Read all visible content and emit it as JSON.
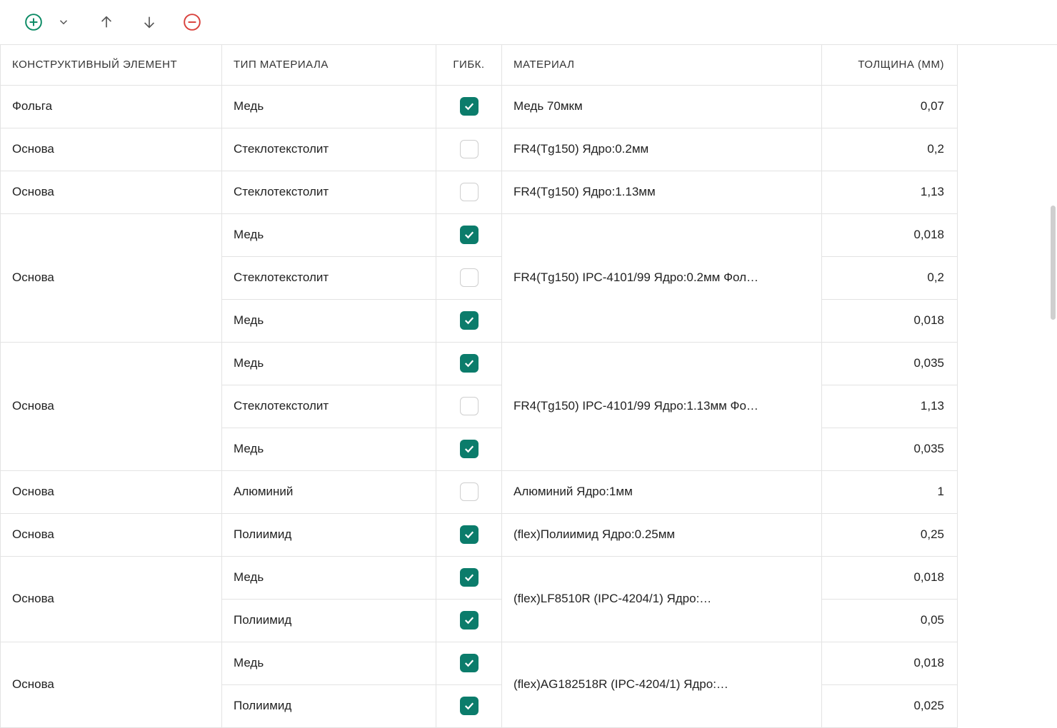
{
  "toolbar": {
    "add_name": "add",
    "dropdown_name": "dropdown",
    "up_name": "move-up",
    "down_name": "move-down",
    "remove_name": "remove"
  },
  "headers": {
    "element": "КОНСТРУКТИВНЫЙ ЭЛЕМЕНТ",
    "type": "ТИП МАТЕРИАЛА",
    "flex": "ГИБК.",
    "material": "МАТЕРИАЛ",
    "thickness": "ТОЛЩИНА (ММ)"
  },
  "rows": [
    {
      "element": "Фольга",
      "material": "Медь 70мкм",
      "sub": [
        {
          "type": "Медь",
          "flex": true,
          "thick": "0,07"
        }
      ]
    },
    {
      "element": "Основа",
      "material": "FR4(Tg150) Ядро:0.2мм",
      "sub": [
        {
          "type": "Стеклотекстолит",
          "flex": false,
          "thick": "0,2"
        }
      ]
    },
    {
      "element": "Основа",
      "material": "FR4(Tg150) Ядро:1.13мм",
      "sub": [
        {
          "type": "Стеклотекстолит",
          "flex": false,
          "thick": "1,13"
        }
      ]
    },
    {
      "element": "Основа",
      "material": "FR4(Tg150) IPC-4101/99 Ядро:0.2мм Фол…",
      "sub": [
        {
          "type": "Медь",
          "flex": true,
          "thick": "0,018"
        },
        {
          "type": "Стеклотекстолит",
          "flex": false,
          "thick": "0,2"
        },
        {
          "type": "Медь",
          "flex": true,
          "thick": "0,018"
        }
      ]
    },
    {
      "element": "Основа",
      "material": "FR4(Tg150) IPC-4101/99 Ядро:1.13мм Фо…",
      "sub": [
        {
          "type": "Медь",
          "flex": true,
          "thick": "0,035"
        },
        {
          "type": "Стеклотекстолит",
          "flex": false,
          "thick": "1,13"
        },
        {
          "type": "Медь",
          "flex": true,
          "thick": "0,035"
        }
      ]
    },
    {
      "element": "Основа",
      "material": "Алюминий Ядро:1мм",
      "sub": [
        {
          "type": "Алюминий",
          "flex": false,
          "thick": "1"
        }
      ]
    },
    {
      "element": "Основа",
      "material": "(flex)Полиимид Ядро:0.25мм",
      "sub": [
        {
          "type": "Полиимид",
          "flex": true,
          "thick": "0,25"
        }
      ]
    },
    {
      "element": "Основа",
      "material": "(flex)LF8510R (IPC-4204/1) Ядро:…",
      "sub": [
        {
          "type": "Медь",
          "flex": true,
          "thick": "0,018"
        },
        {
          "type": "Полиимид",
          "flex": true,
          "thick": "0,05"
        }
      ]
    },
    {
      "element": "Основа",
      "material": "(flex)AG182518R (IPC-4204/1) Ядро:…",
      "sub": [
        {
          "type": "Медь",
          "flex": true,
          "thick": "0,018"
        },
        {
          "type": "Полиимид",
          "flex": true,
          "thick": "0,025"
        }
      ]
    }
  ]
}
